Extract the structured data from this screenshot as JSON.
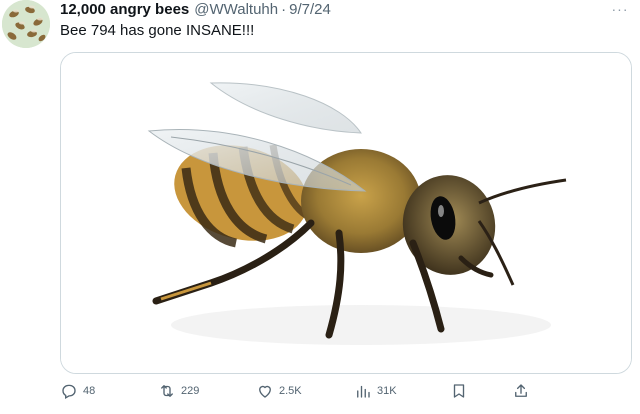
{
  "tweet": {
    "author": {
      "display_name": "12,000 angry bees",
      "handle": "@WWaltuhh",
      "date": "9/7/24"
    },
    "separator": "·",
    "more_label": "···",
    "text": "Bee 794 has gone INSANE!!!",
    "media": {
      "subject": "honeybee photo"
    },
    "actions": {
      "replies": "48",
      "reposts": "229",
      "likes": "2.5K",
      "views": "31K"
    }
  },
  "icons": {
    "reply": "reply-icon",
    "repost": "repost-icon",
    "like": "heart-icon",
    "views": "views-icon",
    "bookmark": "bookmark-icon",
    "share": "share-icon"
  },
  "colors": {
    "text_primary": "#0f1419",
    "text_secondary": "#536471",
    "border": "#cfd9de"
  }
}
